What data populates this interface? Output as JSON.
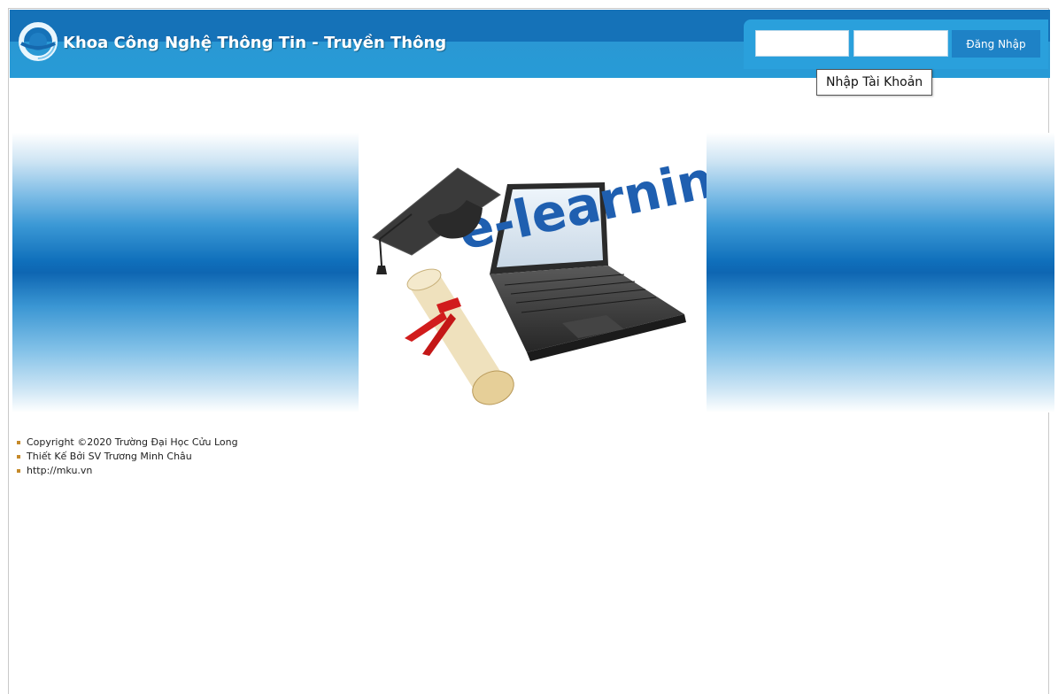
{
  "header": {
    "title": "Khoa Công Nghệ Thông Tin - Truyền Thông",
    "logo_icon": "circular-ring-logo-icon"
  },
  "login": {
    "username_value": "",
    "password_value": "",
    "button_label": "Đăng Nhập",
    "tooltip": "Nhập Tài Khoản"
  },
  "hero": {
    "image_text": "e-learning",
    "image_desc_icons": [
      "graduation-cap-icon",
      "laptop-icon",
      "diploma-scroll-icon"
    ]
  },
  "footer": {
    "items": [
      "Copyright ©2020 Trường Đại Học Cửu Long",
      "Thiết Kế Bởi SV Trương Minh Châu",
      "http://mku.vn"
    ]
  },
  "colors": {
    "header_blue": "#1e8fd0",
    "band_dark": "#0e66b2",
    "button_blue": "#1e82c6",
    "bullet": "#c58a2a"
  }
}
